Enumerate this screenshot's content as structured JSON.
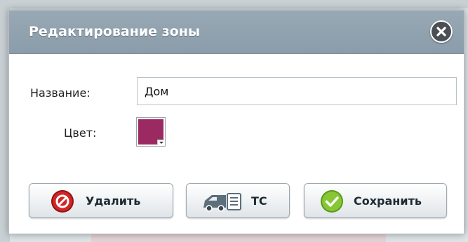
{
  "dialog": {
    "title": "Редактирование зоны",
    "close_icon": "close-icon"
  },
  "form": {
    "name_label": "Название:",
    "name_value": "Дом",
    "color_label": "Цвет:",
    "color_value": "#9b2a62"
  },
  "buttons": {
    "delete_label": "Удалить",
    "delete_icon": "forbidden-icon",
    "vehicle_label": "ТС",
    "vehicle_icon": "vehicle-list-icon",
    "save_label": "Сохранить",
    "save_icon": "checkmark-icon"
  },
  "colors": {
    "titlebar": "#8f9fad",
    "delete_icon": "#cc2222",
    "save_icon": "#7cc02a"
  }
}
